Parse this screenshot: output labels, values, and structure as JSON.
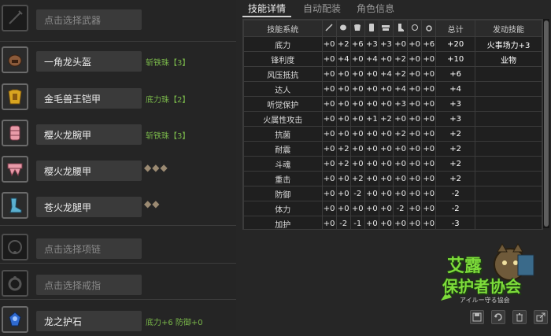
{
  "equipment": [
    {
      "label": "点击选择武器",
      "empty": true,
      "icon": "weapon-icon"
    },
    {
      "label": "一角龙头盔",
      "empty": false,
      "deco": "斩铁珠【3】",
      "icon": "helmet-icon"
    },
    {
      "label": "金毛兽王铠甲",
      "empty": false,
      "deco": "底力珠【2】",
      "icon": "chest-armor-icon"
    },
    {
      "label": "樱火龙腕甲",
      "empty": false,
      "deco": "斩铁珠【3】",
      "icon": "arm-armor-icon"
    },
    {
      "label": "樱火龙腰甲",
      "empty": false,
      "diamonds": "◆◆◆",
      "icon": "waist-armor-icon"
    },
    {
      "label": "苍火龙腿甲",
      "empty": false,
      "diamonds": "◆◆",
      "icon": "leg-armor-icon"
    },
    {
      "label": "点击选择项链",
      "empty": true,
      "icon": "necklace-icon"
    },
    {
      "label": "点击选择戒指",
      "empty": true,
      "icon": "ring-icon"
    },
    {
      "label": "龙之护石",
      "empty": false,
      "deco": "底力+6 防御+0",
      "icon": "talisman-icon"
    }
  ],
  "tabs": [
    "技能详情",
    "自动配装",
    "角色信息"
  ],
  "table": {
    "headers": {
      "name": "技能系统",
      "total": "总计",
      "active": "发动技能"
    },
    "col_icons": [
      "weapon-col-icon",
      "helmet-col-icon",
      "chest-col-icon",
      "arm-col-icon",
      "waist-col-icon",
      "leg-col-icon",
      "necklace-col-icon",
      "ring-col-icon"
    ],
    "rows": [
      {
        "name": "底力",
        "vals": [
          "+0",
          "+2",
          "+6",
          "+3",
          "+3",
          "+0",
          "+0",
          "+6"
        ],
        "total": "+20",
        "active": "火事场力+3"
      },
      {
        "name": "锋利度",
        "vals": [
          "+0",
          "+4",
          "+0",
          "+4",
          "+0",
          "+2",
          "+0",
          "+0"
        ],
        "total": "+10",
        "active": "业物"
      },
      {
        "name": "风压抵抗",
        "vals": [
          "+0",
          "+0",
          "+0",
          "+0",
          "+4",
          "+2",
          "+0",
          "+0"
        ],
        "total": "+6",
        "active": ""
      },
      {
        "name": "达人",
        "vals": [
          "+0",
          "+0",
          "+0",
          "+0",
          "+0",
          "+4",
          "+0",
          "+0"
        ],
        "total": "+4",
        "active": ""
      },
      {
        "name": "听觉保护",
        "vals": [
          "+0",
          "+0",
          "+0",
          "+0",
          "+0",
          "+3",
          "+0",
          "+0"
        ],
        "total": "+3",
        "active": ""
      },
      {
        "name": "火属性攻击",
        "vals": [
          "+0",
          "+0",
          "+0",
          "+1",
          "+2",
          "+0",
          "+0",
          "+0"
        ],
        "total": "+3",
        "active": ""
      },
      {
        "name": "抗菌",
        "vals": [
          "+0",
          "+0",
          "+0",
          "+0",
          "+0",
          "+2",
          "+0",
          "+0"
        ],
        "total": "+2",
        "active": ""
      },
      {
        "name": "耐震",
        "vals": [
          "+0",
          "+2",
          "+0",
          "+0",
          "+0",
          "+0",
          "+0",
          "+0"
        ],
        "total": "+2",
        "active": ""
      },
      {
        "name": "斗魂",
        "vals": [
          "+0",
          "+2",
          "+0",
          "+0",
          "+0",
          "+0",
          "+0",
          "+0"
        ],
        "total": "+2",
        "active": ""
      },
      {
        "name": "重击",
        "vals": [
          "+0",
          "+0",
          "+2",
          "+0",
          "+0",
          "+0",
          "+0",
          "+0"
        ],
        "total": "+2",
        "active": ""
      },
      {
        "name": "防御",
        "vals": [
          "+0",
          "+0",
          "-2",
          "+0",
          "+0",
          "+0",
          "+0",
          "+0"
        ],
        "total": "-2",
        "active": ""
      },
      {
        "name": "体力",
        "vals": [
          "+0",
          "+0",
          "+0",
          "+0",
          "+0",
          "-2",
          "+0",
          "+0"
        ],
        "total": "-2",
        "active": ""
      },
      {
        "name": "加护",
        "vals": [
          "+0",
          "-2",
          "-1",
          "+0",
          "+0",
          "+0",
          "+0",
          "+0"
        ],
        "total": "-3",
        "active": ""
      }
    ]
  },
  "logo": {
    "line1": "艾露",
    "line2": "保护者协会",
    "sub": "アイルー守る協会"
  },
  "bottom_buttons": [
    "save-icon",
    "refresh-icon",
    "trash-icon",
    "share-icon"
  ]
}
